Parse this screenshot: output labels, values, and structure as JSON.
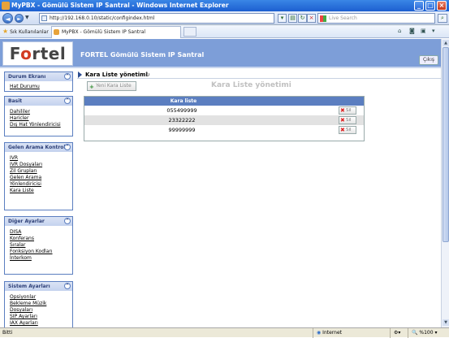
{
  "window": {
    "title": "MyPBX - Gömülü Sistem IP Santral - Windows Internet Explorer"
  },
  "browser": {
    "url": "http://192.168.0.10/static/configindex.html",
    "search_placeholder": "Live Search",
    "favorites_label": "Sık Kullanılanlar",
    "tab_title": "MyPBX - Gömülü Sistem IP Santral"
  },
  "app": {
    "logo_pre": "F",
    "logo_o": "o",
    "logo_post": "rtel",
    "title": "FORTEL Gömülü Sistem IP Santral",
    "logout_label": "Çıkış"
  },
  "sidebar": {
    "sections": [
      {
        "title": "Durum Ekranı",
        "items": [
          "Hat Durumu"
        ]
      },
      {
        "title": "Basit",
        "items": [
          "Dahililer",
          "Haricler",
          "Dış Hat Yönlendiricisi"
        ]
      },
      {
        "title": "Gelen Arama Kontrolü",
        "items": [
          "IVR",
          "IVR Dosyaları",
          "Zil Grupları",
          "Gelen Arama Yönlendiricisi",
          "Kara Liste"
        ]
      },
      {
        "title": "Diğer Ayarlar",
        "items": [
          "DISA",
          "Konferans",
          "Sıralar",
          "Fonksiyon Kodları",
          "İnterkom"
        ]
      },
      {
        "title": "Sistem Ayarları",
        "items": [
          "Opsiyonlar",
          "Bekleme Müzik Dosyaları",
          "SIP Ayarları",
          "IAX Ayarları"
        ]
      }
    ],
    "collapse_glyph": "^"
  },
  "main": {
    "breadcrumb": "Kara Liste yönetimi",
    "refresh_glyph": "↻",
    "add_button": "Yeni Kara Liste",
    "heading": "Kara Liste yönetimi",
    "table": {
      "header": "Kara liste",
      "rows": [
        "055499999",
        "23322222",
        "99999999"
      ],
      "delete_label": "Sil"
    }
  },
  "statusbar": {
    "left": "Bitti",
    "zone": "Internet",
    "zoom": "%100"
  }
}
